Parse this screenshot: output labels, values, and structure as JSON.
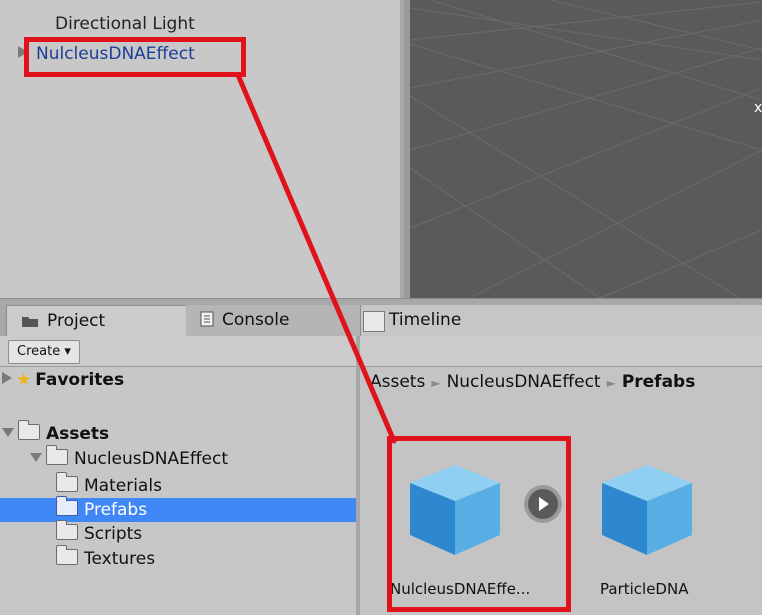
{
  "hierarchy": {
    "items": [
      {
        "label": "Directional Light"
      },
      {
        "label": "NulcleusDNAEffect"
      }
    ]
  },
  "tabs": {
    "project": "Project",
    "console": "Console",
    "timeline": "Timeline"
  },
  "toolbar": {
    "create_label": "Create ▾"
  },
  "tree": {
    "favorites": "Favorites",
    "assets": "Assets",
    "nucleus": "NucleusDNAEffect",
    "materials": "Materials",
    "prefabs": "Prefabs",
    "scripts": "Scripts",
    "textures": "Textures"
  },
  "breadcrumb": {
    "assets": "Assets",
    "nucleus": "NucleusDNAEffect",
    "prefabs": "Prefabs",
    "sep": "►"
  },
  "assets_grid": [
    {
      "label": "NulcleusDNAEffe..."
    },
    {
      "label": "ParticleDNA"
    }
  ],
  "colors": {
    "selection": "#3f86f6",
    "highlight": "#e0131c",
    "hierarchy_selected_text": "#1c3d9a"
  },
  "icons": [
    "folder-icon",
    "star-icon",
    "console-icon",
    "play-icon",
    "cube-icon"
  ]
}
